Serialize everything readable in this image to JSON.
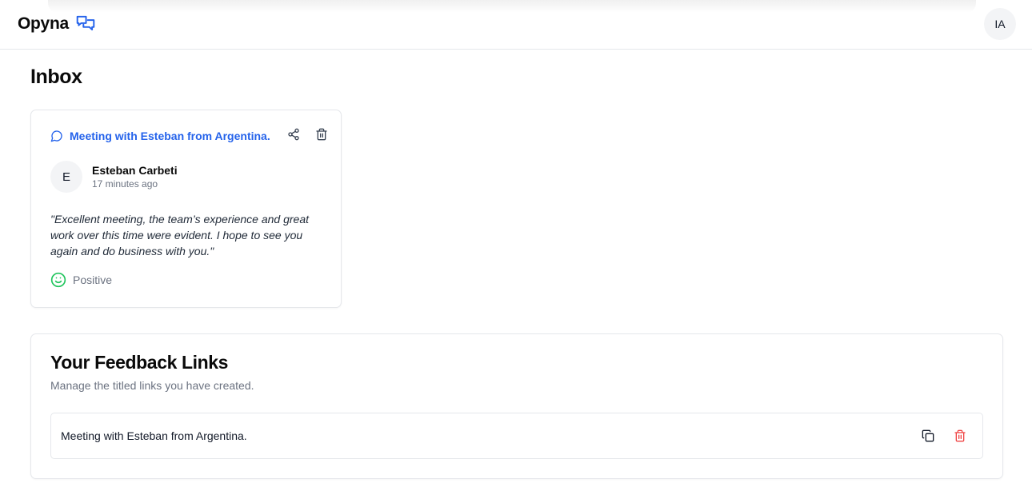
{
  "header": {
    "brand": "Opyna",
    "brand_icon": "chat-bubbles-icon",
    "user_initials": "IA"
  },
  "inbox": {
    "title": "Inbox",
    "card": {
      "title": "Meeting with Esteban from Argentina.",
      "title_icon": "message-circle-icon",
      "author_initial": "E",
      "author_name": "Esteban Carbeti",
      "time_ago": "17 minutes ago",
      "quote": "\"Excellent meeting, the team’s experience and great work over this time were evident. I hope to see you again and do business with you.\"",
      "sentiment": "Positive",
      "sentiment_icon": "smile-icon",
      "actions": [
        "share-icon",
        "trash-icon"
      ]
    }
  },
  "feedback_links": {
    "title": "Your Feedback Links",
    "subtitle": "Manage the titled links you have created.",
    "items": [
      {
        "label": "Meeting with Esteban from Argentina.",
        "actions": [
          "copy-icon",
          "trash-icon"
        ]
      }
    ]
  },
  "colors": {
    "accent": "#2563eb",
    "positive": "#22c55e",
    "danger": "#ef4444",
    "border": "#e5e7eb",
    "muted_text": "#6b7280"
  }
}
